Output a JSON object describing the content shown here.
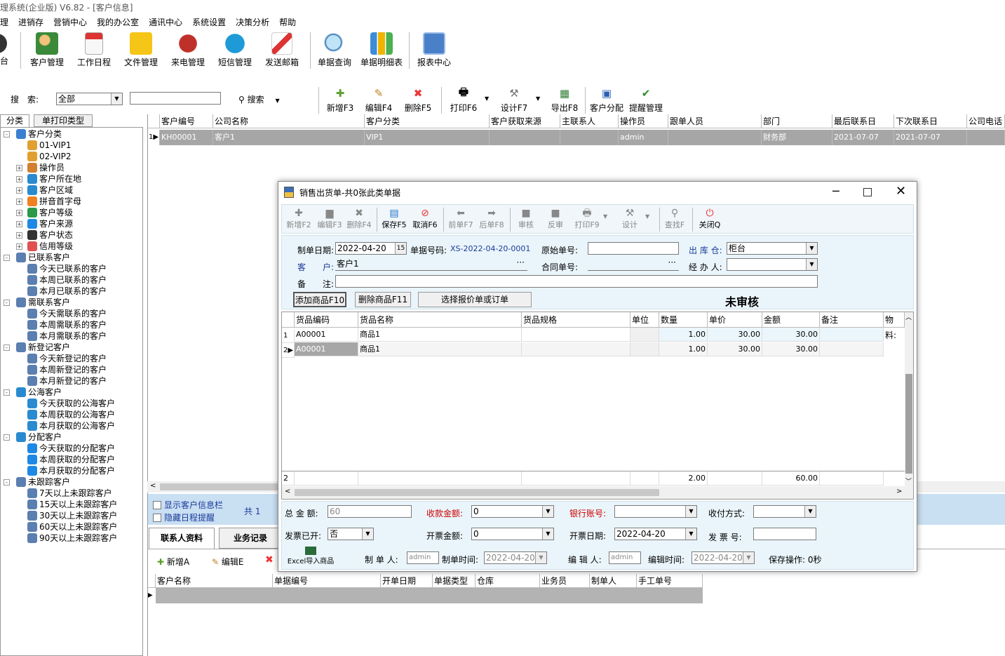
{
  "window": {
    "title": "理系统(企业版) V6.82 - [客户信息]"
  },
  "menu": [
    "理",
    "进销存",
    "营销中心",
    "我的办公室",
    "通讯中心",
    "系统设置",
    "决策分析",
    "帮助"
  ],
  "toolbar": {
    "first": "台",
    "items": [
      "客户管理",
      "工作日程",
      "文件管理",
      "来电管理",
      "短信管理",
      "发送邮箱",
      "单据查询",
      "单据明细表",
      "报表中心"
    ]
  },
  "search": {
    "label": "搜　索:",
    "scope": "全部",
    "value": "",
    "button": "搜索",
    "actions": [
      "新增F3",
      "编辑F4",
      "删除F5",
      "打印F6",
      "设计F7",
      "导出F8",
      "客户分配",
      "提醒管理"
    ]
  },
  "left_tabs": [
    "分类",
    "单打印类型"
  ],
  "tree": [
    {
      "label": "客户分类",
      "level": 0,
      "exp": "-",
      "icon": "folder-icon"
    },
    {
      "label": "01-VIP1",
      "level": 1,
      "icon": "book-icon"
    },
    {
      "label": "02-VIP2",
      "level": 1,
      "icon": "book-icon"
    },
    {
      "label": "操作员",
      "level": 1,
      "exp": "+",
      "icon": "users-icon"
    },
    {
      "label": "客户所在地",
      "level": 1,
      "exp": "+",
      "icon": "globe-icon"
    },
    {
      "label": "客户区域",
      "level": 1,
      "exp": "+",
      "icon": "globe-icon"
    },
    {
      "label": "拼音首字母",
      "level": 1,
      "exp": "+",
      "icon": "letter-icon"
    },
    {
      "label": "客户等级",
      "level": 1,
      "exp": "+",
      "icon": "share-icon"
    },
    {
      "label": "客户来源",
      "level": 1,
      "exp": "+",
      "icon": "source-icon"
    },
    {
      "label": "客户状态",
      "level": 1,
      "exp": "+",
      "icon": "status-icon"
    },
    {
      "label": "信用等级",
      "level": 1,
      "exp": "+",
      "icon": "credit-icon"
    },
    {
      "label": "已联系客户",
      "level": 0,
      "exp": "-",
      "icon": "phone-icon"
    },
    {
      "label": "今天已联系的客户",
      "level": 1,
      "icon": "phone-icon"
    },
    {
      "label": "本周已联系的客户",
      "level": 1,
      "icon": "phone-icon"
    },
    {
      "label": "本月已联系的客户",
      "level": 1,
      "icon": "phone-icon"
    },
    {
      "label": "需联系客户",
      "level": 0,
      "exp": "-",
      "icon": "phone-icon"
    },
    {
      "label": "今天需联系的客户",
      "level": 1,
      "icon": "phone-icon"
    },
    {
      "label": "本周需联系的客户",
      "level": 1,
      "icon": "phone-icon"
    },
    {
      "label": "本月需联系的客户",
      "level": 1,
      "icon": "phone-icon"
    },
    {
      "label": "新登记客户",
      "level": 0,
      "exp": "-",
      "icon": "phone-icon"
    },
    {
      "label": "今天新登记的客户",
      "level": 1,
      "icon": "phone-icon"
    },
    {
      "label": "本周新登记的客户",
      "level": 1,
      "icon": "phone-icon"
    },
    {
      "label": "本月新登记的客户",
      "level": 1,
      "icon": "phone-icon"
    },
    {
      "label": "公海客户",
      "level": 0,
      "exp": "-",
      "icon": "globe-icon"
    },
    {
      "label": "今天获取的公海客户",
      "level": 1,
      "icon": "globe-icon"
    },
    {
      "label": "本周获取的公海客户",
      "level": 1,
      "icon": "globe-icon"
    },
    {
      "label": "本月获取的公海客户",
      "level": 1,
      "icon": "globe-icon"
    },
    {
      "label": "分配客户",
      "level": 0,
      "exp": "-",
      "icon": "globe-icon"
    },
    {
      "label": "今天获取的分配客户",
      "level": 1,
      "icon": "source-icon"
    },
    {
      "label": "本周获取的分配客户",
      "level": 1,
      "icon": "source-icon"
    },
    {
      "label": "本月获取的分配客户",
      "level": 1,
      "icon": "source-icon"
    },
    {
      "label": "未跟踪客户",
      "level": 0,
      "exp": "-",
      "icon": "phone-icon"
    },
    {
      "label": "7天以上未跟踪客户",
      "level": 1,
      "icon": "phone-icon"
    },
    {
      "label": "15天以上未跟踪客户",
      "level": 1,
      "icon": "phone-icon"
    },
    {
      "label": "30天以上未跟踪客户",
      "level": 1,
      "icon": "phone-icon"
    },
    {
      "label": "60天以上未跟踪客户",
      "level": 1,
      "icon": "phone-icon"
    },
    {
      "label": "90天以上未跟踪客户",
      "level": 1,
      "icon": "phone-icon"
    }
  ],
  "customer_grid": {
    "columns": [
      "客户编号",
      "公司名称",
      "客户分类",
      "客户获取来源",
      "主联系人",
      "操作员",
      "跟单人员",
      "部门",
      "最后联系日",
      "下次联系日",
      "公司电话"
    ],
    "rows": [
      [
        "KH00001",
        "客户1",
        "VIP1",
        "",
        "",
        "admin",
        "",
        "财务部",
        "2021-07-07",
        "2021-07-07",
        ""
      ]
    ],
    "row_number": "1"
  },
  "options": {
    "show_info": "显示客户信息栏",
    "hide_reminder": "隐藏日程提醒",
    "total": "共 1"
  },
  "bottom_tabs": [
    "联系人资料",
    "业务记录"
  ],
  "bottom_actions": [
    "新增A",
    "编辑E"
  ],
  "bottom_grid": {
    "columns": [
      "客户名称",
      "单据编号",
      "开单日期",
      "单据类型",
      "仓库",
      "业务员",
      "制单人",
      "手工单号"
    ]
  },
  "dialog": {
    "title": "销售出货单-共0张此类单据",
    "toolbar": [
      "新增F2",
      "编辑F3",
      "删除F4",
      "保存F5",
      "取消F6",
      "前单F7",
      "后单F8",
      "审核",
      "反审",
      "打印F9",
      "设计",
      "查找F",
      "关闭Q"
    ],
    "form": {
      "date_label": "制单日期:",
      "date": "2022-04-20",
      "no_label": "单据号码:",
      "no": "XS-2022-04-20-0001",
      "orig_label": "原始单号:",
      "orig": "",
      "wh_label": "出 库 仓:",
      "wh": "柜台",
      "cust_label": "客　　户:",
      "cust": "客户1",
      "contract_label": "合同单号:",
      "contract": "",
      "handler_label": "经 办 人:",
      "handler": "",
      "note_label": "备　　注:",
      "note": "",
      "btn_add": "添加商品F10",
      "btn_del": "删除商品F11",
      "btn_select": "选择报价单或订单",
      "status": "未审核"
    },
    "grid": {
      "columns": [
        "货品编码",
        "货品名称",
        "货品规格",
        "单位",
        "数量",
        "单价",
        "金额",
        "备注",
        "物料:"
      ],
      "rows": [
        {
          "n": "1",
          "code": "A00001",
          "name": "商品1",
          "spec": "",
          "unit": "",
          "qty": "1.00",
          "price": "30.00",
          "amount": "30.00",
          "note": ""
        },
        {
          "n": "2",
          "code": "A00001",
          "name": "商品1",
          "spec": "",
          "unit": "",
          "qty": "1.00",
          "price": "30.00",
          "amount": "30.00",
          "note": ""
        }
      ],
      "footer": {
        "n": "2",
        "qty": "2.00",
        "amount": "60.00"
      }
    },
    "footer": {
      "total_label": "总 金 额:",
      "total": "60",
      "recv_label": "收款金额:",
      "recv": "0",
      "bank_label": "银行账号:",
      "bank": "",
      "pay_label": "收付方式:",
      "pay": "",
      "inv_label": "发票已开:",
      "inv": "否",
      "invamt_label": "开票金额:",
      "invamt": "0",
      "invdate_label": "开票日期:",
      "invdate": "2022-04-20",
      "invno_label": "发 票 号:",
      "invno": "",
      "excel": "Excel导入商品",
      "maker_label": "制 单 人:",
      "maker": "admin",
      "maketime_label": "制单时间:",
      "maketime": "2022-04-20",
      "editor_label": "编 辑 人:",
      "editor": "admin",
      "edittime_label": "编辑时间:",
      "edittime": "2022-04-20",
      "save_label": "保存操作:",
      "save": "0秒"
    }
  }
}
